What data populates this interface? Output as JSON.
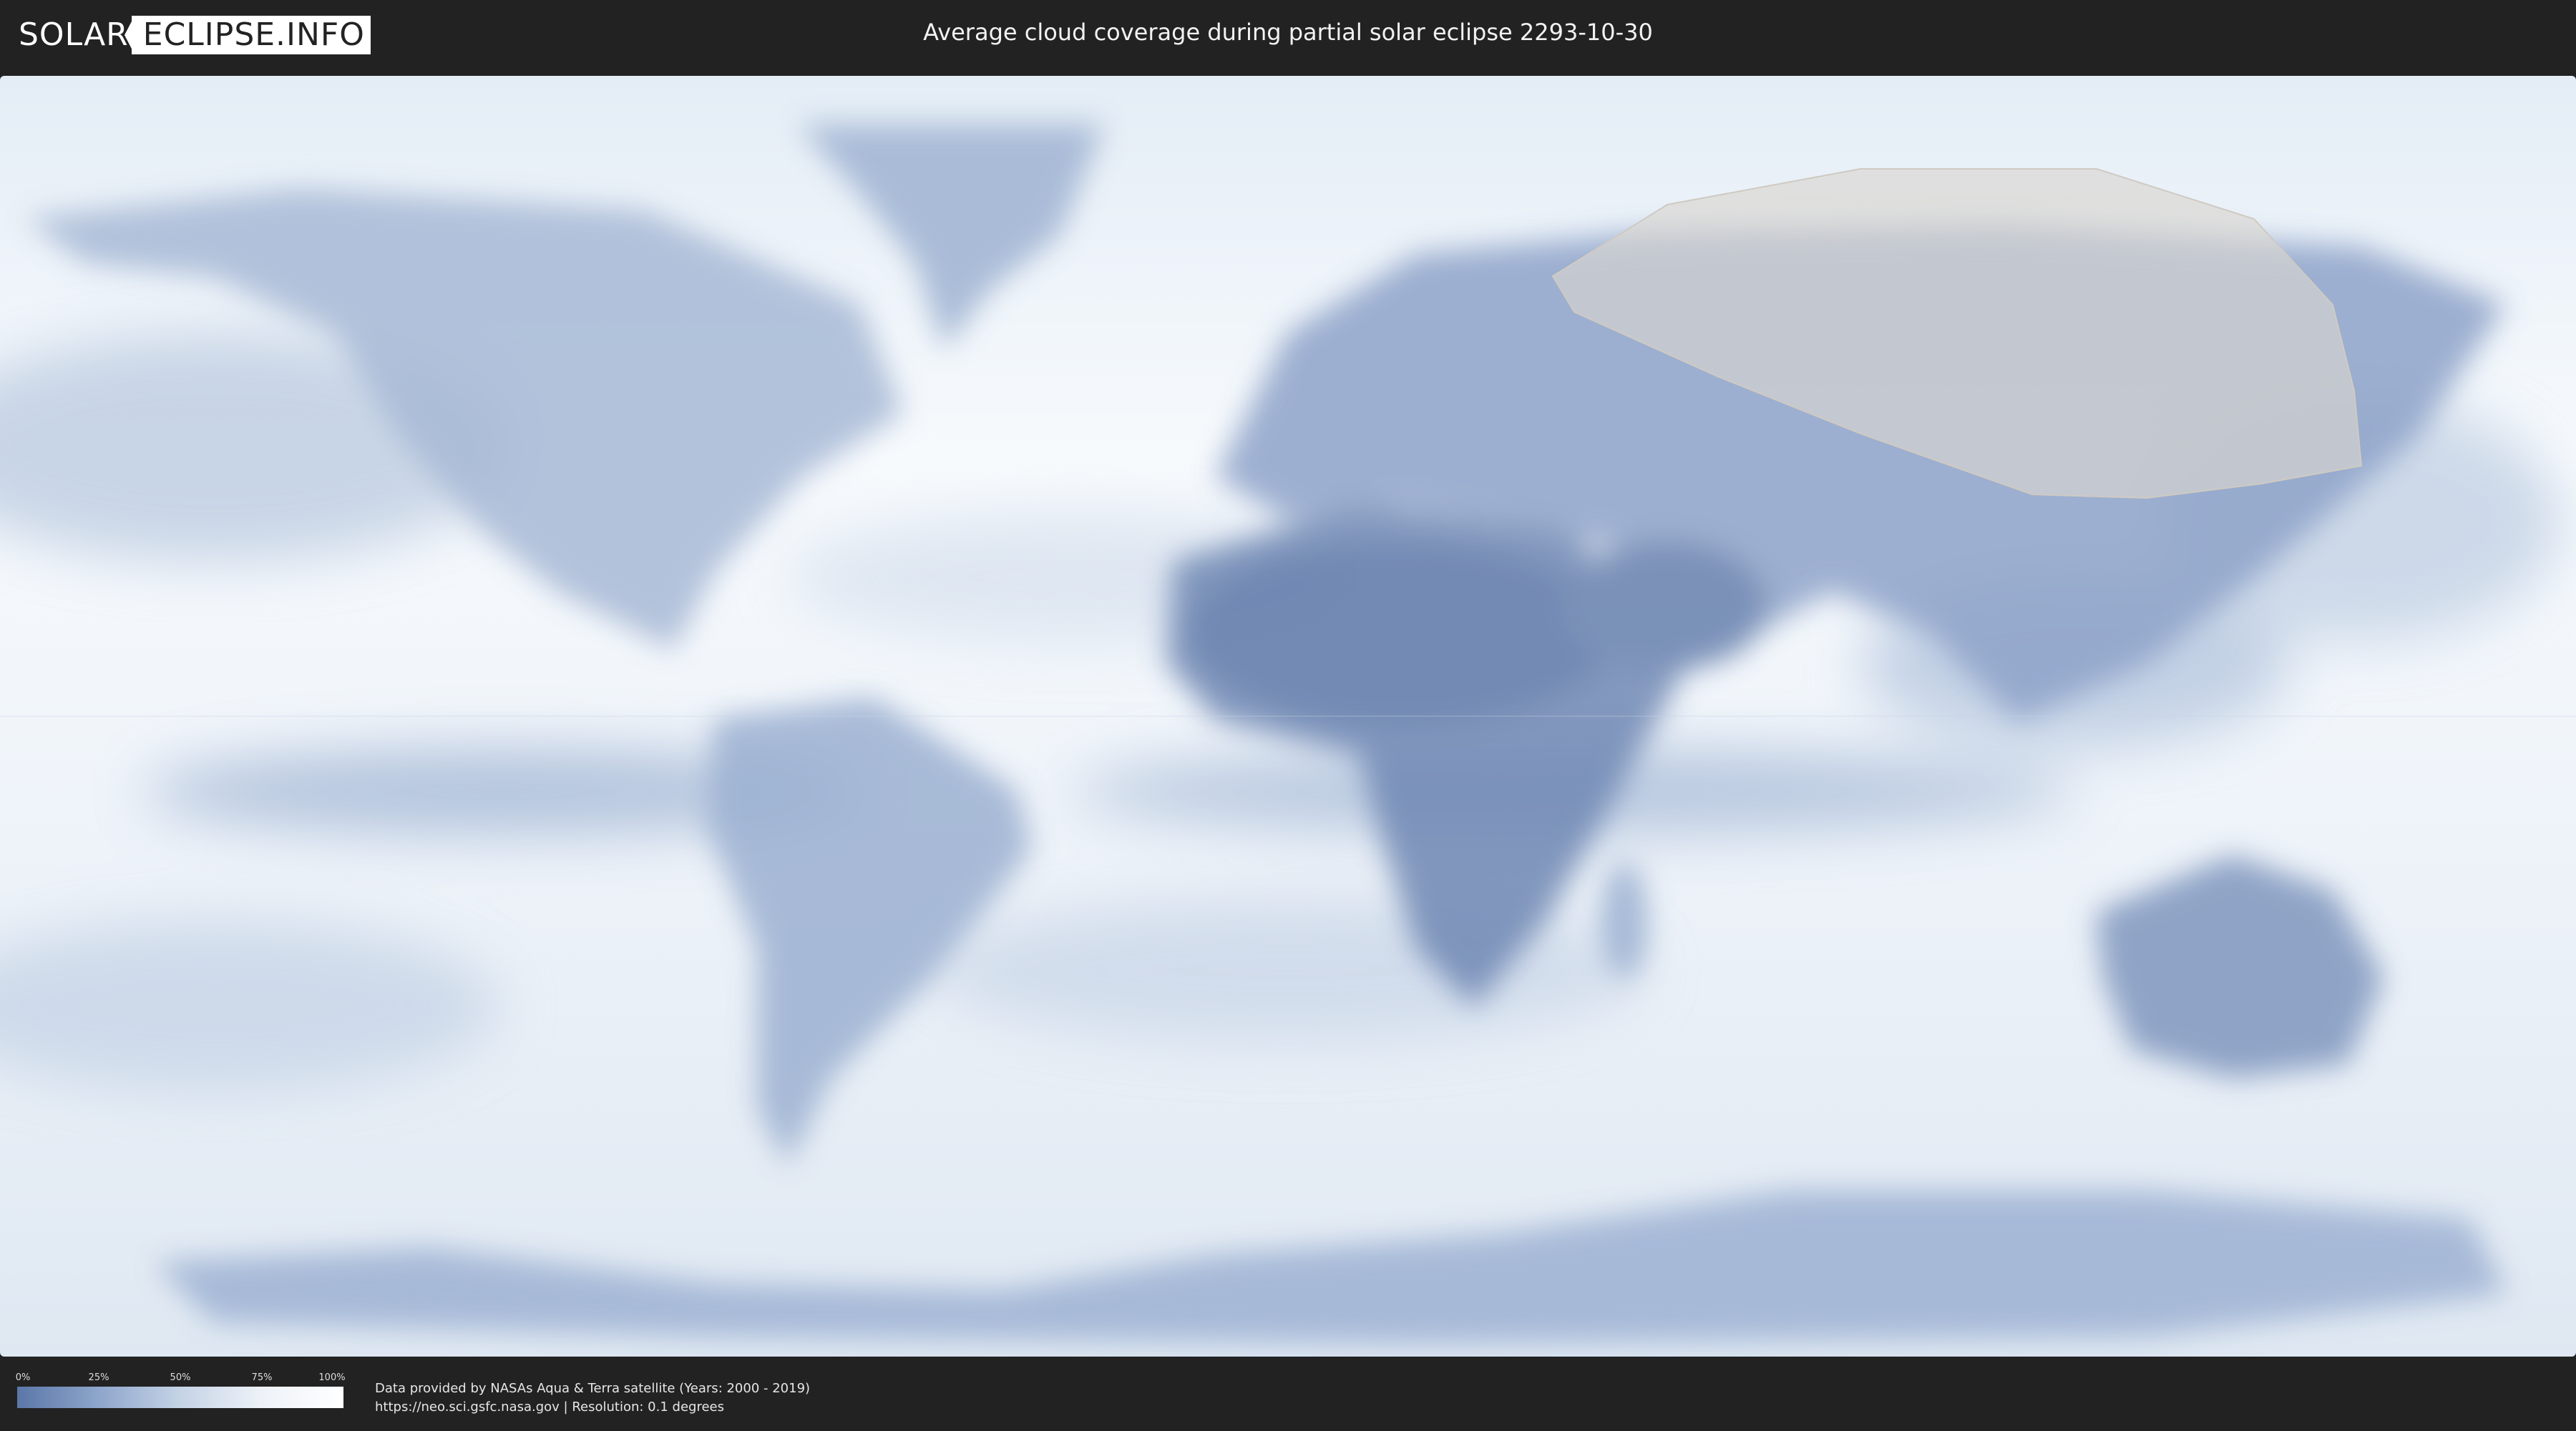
{
  "header": {
    "logo": {
      "part1": "SOLAR",
      "part2": "ECLIPSE.INFO"
    },
    "title": "Average cloud coverage during partial solar eclipse 2293-10-30"
  },
  "legend": {
    "ticks": [
      "0%",
      "25%",
      "50%",
      "75%",
      "100%"
    ],
    "colors": {
      "low": "#5b77a8",
      "high": "#ffffff"
    }
  },
  "credits": {
    "line1": "Data provided by NASAs Aqua & Terra satellite (Years: 2000 - 2019)",
    "line2": "https://neo.sci.gsfc.nasa.gov | Resolution: 0.1 degrees"
  },
  "colors": {
    "background": "#222222",
    "cloudy": "#f4f7fb",
    "clear": "#5b77a8",
    "eclipse_zone": "#d9d5cf"
  }
}
